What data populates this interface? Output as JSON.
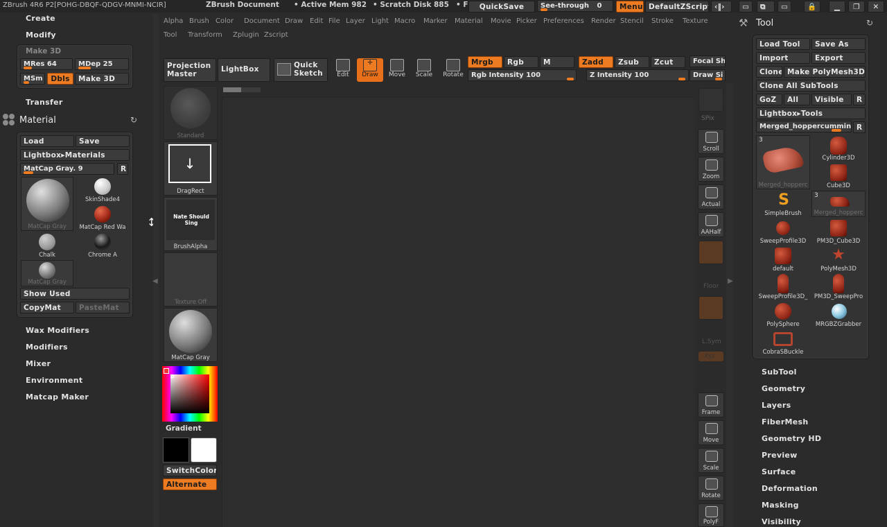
{
  "titlebar": {
    "app": "ZBrush 4R6 P2[POHG-DBQF-QDGV-MNMI-NCIR]",
    "document": "ZBrush Document",
    "active_mem": "• Active Mem 982",
    "scratch_disk": "• Scratch Disk 885",
    "fr": "• F",
    "quicksave": "QuickSave",
    "see_through": "See-through",
    "see_through_value": "0",
    "see_through_level": 0,
    "menus": "Menus",
    "default_zscript": "DefaultZScript"
  },
  "menubar": {
    "row1": [
      "Alpha",
      "Brush",
      "Color",
      "Document",
      "Draw",
      "Edit",
      "File",
      "Layer",
      "Light",
      "Macro",
      "Marker",
      "Material",
      "Movie",
      "Picker",
      "Preferences",
      "Render",
      "Stencil",
      "Stroke",
      "Texture"
    ],
    "row2": [
      "Tool",
      "Transform",
      "Zplugin",
      "Zscript"
    ]
  },
  "left_panel": {
    "create": "Create",
    "modify": "Modify",
    "make3d_title": "Make 3D",
    "mres": "MRes 64",
    "mdep": "MDep 25",
    "msm": "MSm",
    "dbls": "Dbls",
    "make3d_btn": "Make 3D",
    "transfer": "Transfer",
    "material_title": "Material",
    "load": "Load",
    "save": "Save",
    "lightbox_materials": "Lightbox▸Materials",
    "matcap_slider": "MatCap Gray. 9",
    "r": "R",
    "materials": [
      {
        "name": "MatCap Gray"
      },
      {
        "name": "SkinShade4"
      },
      {
        "name": "MatCap Red Wa"
      },
      {
        "name": "Chalk"
      },
      {
        "name": "Chrome A"
      },
      {
        "name": "MatCap Gray"
      }
    ],
    "show_used": "Show Used",
    "copymat": "CopyMat",
    "pastemat": "PasteMat",
    "lower_menu": [
      "Wax Modifiers",
      "Modifiers",
      "Mixer",
      "Environment",
      "Matcap Maker"
    ]
  },
  "shelf": {
    "projection_master": "Projection Master",
    "lightbox": "LightBox",
    "quick_sketch": "Quick Sketch",
    "edit": "Edit",
    "draw": "Draw",
    "move": "Move",
    "scale": "Scale",
    "rotate": "Rotate",
    "mrgb": "Mrgb",
    "rgb": "Rgb",
    "m": "M",
    "rgb_intensity": "Rgb Intensity 100",
    "zadd": "Zadd",
    "zsub": "Zsub",
    "zcut": "Zcut",
    "z_intensity": "Z Intensity 100",
    "focal_shift": "Focal Sh",
    "draw_size": "Draw Si"
  },
  "left_tray": {
    "brush_label": "Standard",
    "stroke_label": "DragRect",
    "alpha_text": "Nate Should Sing",
    "alpha_label": "BrushAlpha",
    "texture_label": "Texture Off",
    "material_label": "MatCap Gray",
    "gradient": "Gradient",
    "switchcolor": "SwitchColor",
    "alternate": "Alternate"
  },
  "right_shelf": {
    "spix": "SPix",
    "buttons": [
      "Scroll",
      "Zoom",
      "Actual",
      "AAHalf"
    ],
    "floor": "Floor",
    "lsym": "L.Sym",
    "xyz": "Xyz",
    "frame": "Frame",
    "move": "Move",
    "scale": "Scale",
    "rotate": "Rotate",
    "polyf": "PolyF"
  },
  "tool_panel": {
    "title": "Tool",
    "load_tool": "Load Tool",
    "save_as": "Save As",
    "import": "Import",
    "export": "Export",
    "clone": "Clone",
    "make_polymesh": "Make PolyMesh3D",
    "clone_all": "Clone All SubTools",
    "goz": "GoZ",
    "all": "All",
    "visible": "Visible",
    "r": "R",
    "lightbox_tools": "Lightbox▸Tools",
    "current_tool": "Merged_hoppercummin",
    "tools": [
      {
        "name": "Merged_hopperc",
        "badge": "3"
      },
      {
        "name": "Cylinder3D"
      },
      {
        "name": "Cube3D"
      },
      {
        "name": "SimpleBrush"
      },
      {
        "name": "Merged_hopperc",
        "badge": "3"
      },
      {
        "name": "SweepProfile3D"
      },
      {
        "name": "PM3D_Cube3D"
      },
      {
        "name": "default"
      },
      {
        "name": "PolyMesh3D"
      },
      {
        "name": "SweepProfile3D_"
      },
      {
        "name": "PM3D_SweepPro"
      },
      {
        "name": "PolySphere"
      },
      {
        "name": "MRGBZGrabber"
      },
      {
        "name": "CobraSBuckle"
      }
    ],
    "sub_menu": [
      "SubTool",
      "Geometry",
      "Layers",
      "FiberMesh",
      "Geometry HD",
      "Preview",
      "Surface",
      "Deformation",
      "Masking",
      "Visibility"
    ]
  }
}
